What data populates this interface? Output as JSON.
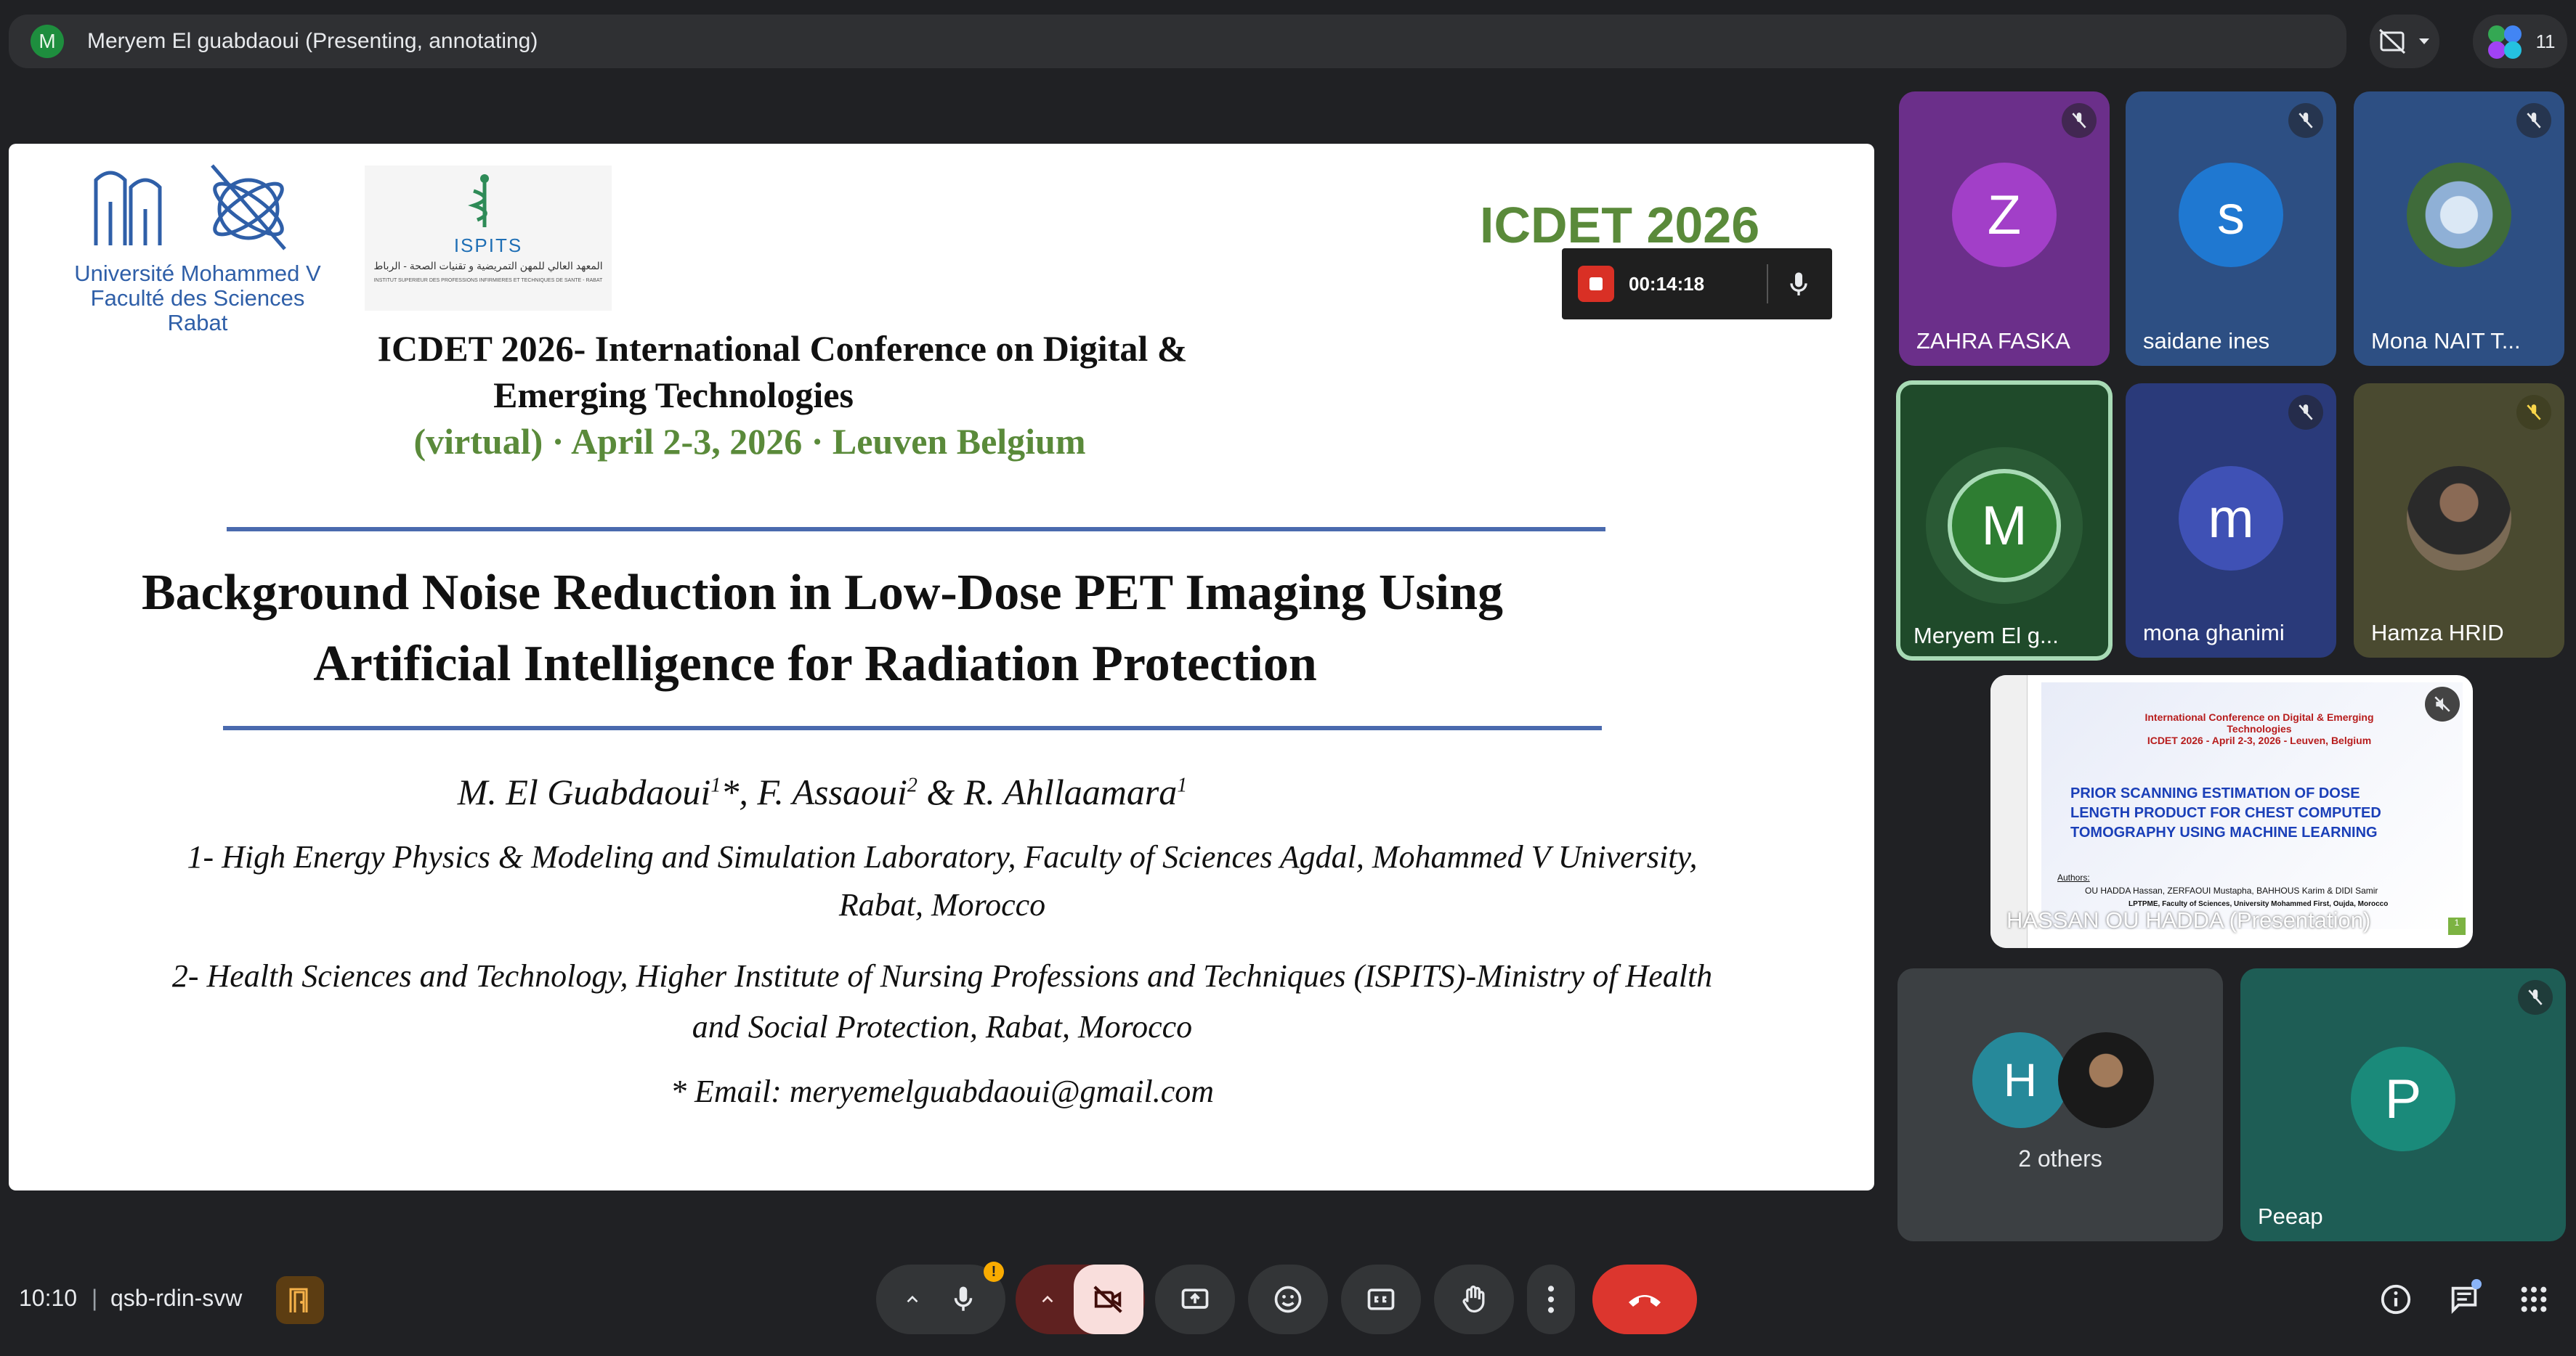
{
  "presenter_bar": {
    "avatar_letter": "M",
    "label": "Meryem El guabdaoui (Presenting, annotating)"
  },
  "top_right": {
    "participant_count": "11"
  },
  "slide": {
    "uni_logo": {
      "line1": "Université Mohammed V",
      "line2": "Faculté des Sciences",
      "line3": "Rabat"
    },
    "ispits_logo": {
      "name": "ISPITS",
      "arabic": "المعهد العالي للمهن التمريضية و تقنيات الصحة - الرباط",
      "fine_print": "INSTITUT SUPERIEUR DES PROFESSIONS INFIRMIERES ET TECHNIQUES DE SANTE - RABAT"
    },
    "conf_short": "ICDET 2026",
    "recording": {
      "time": "00:14:18"
    },
    "conf_line1": "ICDET 2026- International Conference on Digital &",
    "conf_line2": "Emerging Technologies",
    "conf_line3": "(virtual) · April 2-3, 2026 · Leuven Belgium",
    "title_line1": "Background Noise Reduction in Low-Dose PET Imaging Using",
    "title_line2": "Artificial Intelligence for Radiation Protection",
    "authors": {
      "a1": "M. El Guabdaoui",
      "a1_sup": "1",
      "a1_mark": "*,",
      "a2": "F.  Assaoui",
      "a2_sup": "2",
      "a3": "& R. Ahllaamara",
      "a3_sup": "1"
    },
    "aff1_line1": "1- High Energy Physics & Modeling and Simulation Laboratory, Faculty of Sciences Agdal, Mohammed V University,",
    "aff1_line2": "Rabat, Morocco",
    "aff2_line1": "2- Health Sciences and Technology, Higher Institute of Nursing Professions and Techniques (ISPITS)-Ministry of Health",
    "aff2_line2": "and Social Protection, Rabat, Morocco",
    "email": "* Email: meryemelguabdaoui@gmail.com"
  },
  "participants": [
    {
      "name": "ZAHRA FASKA",
      "letter": "Z",
      "bg": "#6b2f8a",
      "avatar_color": "#a23fc8",
      "muted": true
    },
    {
      "name": "saidane ines",
      "letter": "s",
      "bg": "#2d4f83",
      "avatar_color": "#1f78d1",
      "muted": true
    },
    {
      "name": "Mona NAIT T...",
      "letter": "",
      "bg": "#2d4f83",
      "avatar_color": "#9fb3cc",
      "muted": true
    },
    {
      "name": "Meryem El g...",
      "letter": "M",
      "bg": "#1f4a2a",
      "avatar_color": "#2e7d32",
      "muted": false,
      "speaking": true
    },
    {
      "name": "mona ghanimi",
      "letter": "m",
      "bg": "#2a3a7a",
      "avatar_color": "#3f51b5",
      "muted": true
    },
    {
      "name": "Hamza HRID",
      "letter": "",
      "bg": "#4a4a30",
      "avatar_color": "#6b5a45",
      "muted": true
    }
  ],
  "presentation_tile": {
    "label": "HASSAN OU HADDA (Presentation)",
    "slide_conf_line1": "International Conference on Digital & Emerging",
    "slide_conf_line2": "Technologies",
    "slide_conf_line3": "ICDET 2026 - April 2-3, 2026 - Leuven, Belgium",
    "slide_title_line1": "PRIOR SCANNING ESTIMATION OF DOSE",
    "slide_title_line2": "LENGTH PRODUCT FOR CHEST COMPUTED",
    "slide_title_line3": "TOMOGRAPHY USING MACHINE LEARNING",
    "slide_authors_label": "Authors:",
    "slide_authors": "OU HADDA Hassan, ZERFAOUI Mustapha, BAHHOUS Karim & DIDI Samir",
    "slide_affiliation": "LPTPME, Faculty of Sciences, University Mohammed First, Oujda, Morocco",
    "slide_page": "1"
  },
  "others_tile": {
    "label": "2 others",
    "letter": "H"
  },
  "peeap_tile": {
    "name": "Peeap",
    "letter": "P"
  },
  "bottom": {
    "time": "10:10",
    "separator": "|",
    "meeting_code": "qsb-rdin-svw",
    "mic_warning": "!"
  },
  "colors": {
    "background": "#202124",
    "leave_red": "#d93025",
    "slide_green": "#5a8a3a",
    "rule_blue": "#4a6aae",
    "speaking_outline": "#a8dab5"
  },
  "icons": [
    "mic-off-icon",
    "camera-off-icon",
    "present-icon",
    "emoji-icon",
    "captions-icon",
    "raise-hand-icon",
    "more-options-icon",
    "end-call-icon",
    "info-icon",
    "chat-icon",
    "activities-icon",
    "door-icon",
    "layout-icon"
  ]
}
